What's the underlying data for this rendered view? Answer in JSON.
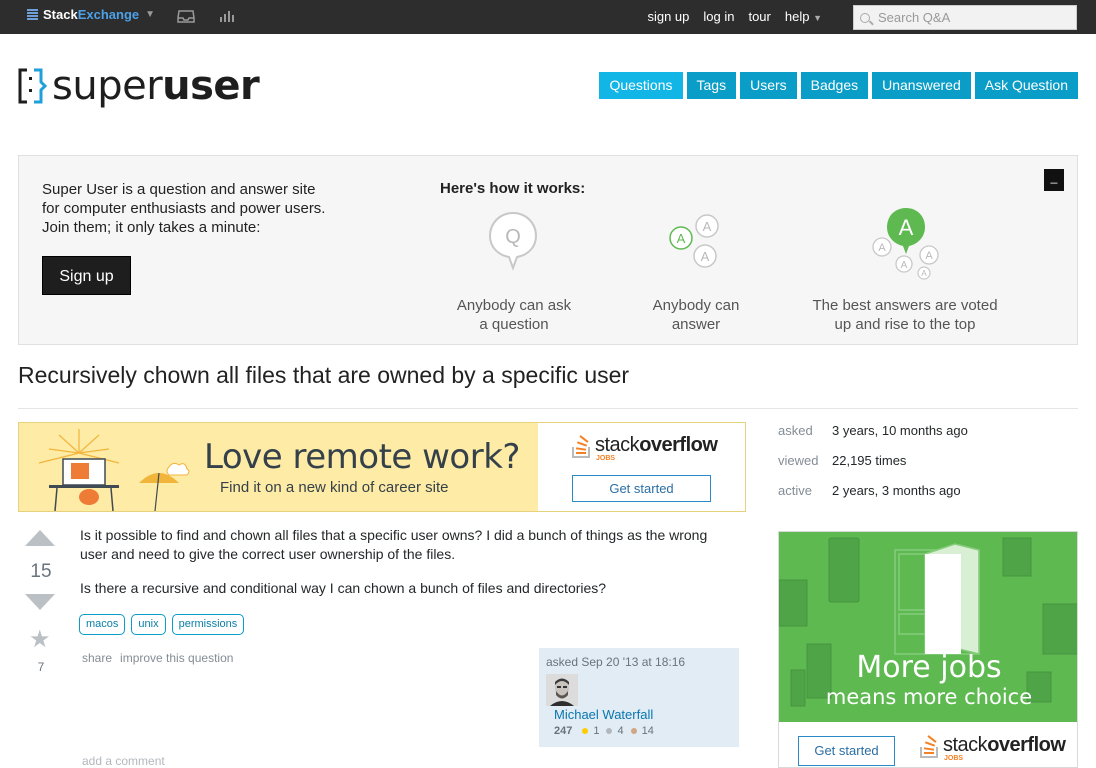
{
  "topbar": {
    "brand_part1": "Stack",
    "brand_part2": "Exchange",
    "links": [
      "sign up",
      "log in",
      "tour",
      "help"
    ],
    "search_placeholder": "Search Q&A"
  },
  "site": {
    "logo_part1": "super",
    "logo_part2": "user"
  },
  "nav": [
    "Questions",
    "Tags",
    "Users",
    "Badges",
    "Unanswered",
    "Ask Question"
  ],
  "hero": {
    "line1": "Super User is a question and answer site",
    "line2": "for computer enthusiasts and power users.",
    "line3": "Join them; it only takes a minute:",
    "signup": "Sign up",
    "how_title": "Here's how it works:",
    "steps": [
      {
        "l1": "Anybody can ask",
        "l2": "a question"
      },
      {
        "l1": "Anybody can",
        "l2": "answer"
      },
      {
        "l1": "The best answers are voted",
        "l2": "up and rise to the top"
      }
    ],
    "close": "_"
  },
  "question": {
    "title": "Recursively chown all files that are owned by a specific user",
    "votes": "15",
    "favorites": "7",
    "body_p1_l1": "Is it possible to find and chown all files that a specific user owns? I did a bunch of things as the wrong",
    "body_p1_l2": "user and need to give the correct user ownership of the files.",
    "body_p2": "Is there a recursive and conditional way I can chown a bunch of files and directories?",
    "tags": [
      "macos",
      "unix",
      "permissions"
    ],
    "menu": [
      "share",
      "improve this question"
    ],
    "add_comment": "add a comment",
    "owner": {
      "asked": "asked Sep 20 '13 at 18:16",
      "name": "Michael Waterfall",
      "reputation": "247",
      "gold": "1",
      "silver": "4",
      "bronze": "14"
    }
  },
  "banner_ad": {
    "headline": "Love remote work?",
    "sub": "Find it on a new kind of career site",
    "brand1": "stack",
    "brand2": "overflow",
    "jobs": "JOBS",
    "button": "Get started"
  },
  "stats": [
    {
      "label": "asked",
      "value": "3 years, 10 months ago"
    },
    {
      "label": "viewed",
      "value": "22,195 times"
    },
    {
      "label": "active",
      "value": "2 years, 3 months ago"
    }
  ],
  "side_ad": {
    "line1": "More jobs",
    "line2": "means more choice",
    "button": "Get started",
    "brand1": "stack",
    "brand2": "overflow",
    "jobs": "JOBS"
  },
  "colors": {
    "nav_bg": "#0a9dc7",
    "nav_active": "#12b6e6",
    "link": "#0a76b0",
    "gold": "#ffcc01",
    "silver": "#b4b8bc",
    "bronze": "#d1a684",
    "answer_green": "#5eb951"
  }
}
